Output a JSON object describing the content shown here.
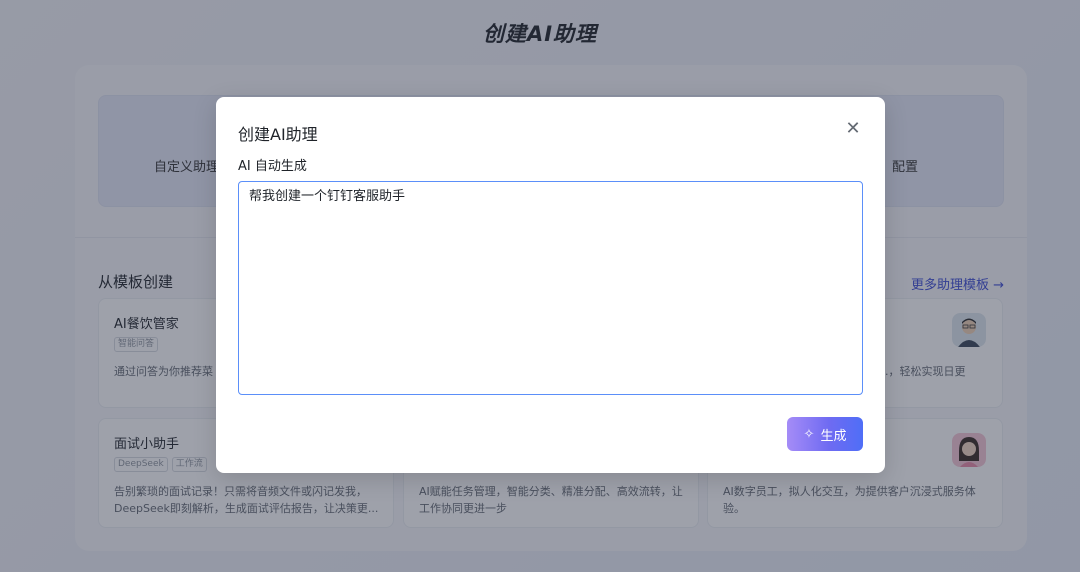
{
  "page": {
    "title": "创建AI助理"
  },
  "create_options": {
    "left_label": "自定义助理",
    "right_label": "配置"
  },
  "templates_section": {
    "title": "从模板创建",
    "more_link": "更多助理模板"
  },
  "templates": [
    {
      "name": "AI餐饮管家",
      "tags": [
        "智能问答"
      ],
      "desc": "通过问答为你推荐菜"
    },
    {
      "name": "",
      "tags": [],
      "desc": "",
      "hidden": true
    },
    {
      "name": "",
      "tags": [],
      "desc": "...，轻松实现日更",
      "avatar": "male-avatar"
    },
    {
      "name": "面试小助手",
      "tags": [
        "DeepSeek",
        "工作流"
      ],
      "desc": "告别繁琐的面试记录！只需将音频文件或闪记发我，DeepSeek即刻解析，生成面试评估报告，让决策更..."
    },
    {
      "name": "",
      "tags": [],
      "desc": "AI赋能任务管理，智能分类、精准分配、高效流转，让工作协同更进一步"
    },
    {
      "name": "",
      "tags": [],
      "desc": "AI数字员工，拟人化交互，为提供客户沉浸式服务体验。",
      "avatar": "female-avatar"
    }
  ],
  "modal": {
    "title": "创建AI助理",
    "field_label": "AI 自动生成",
    "prompt_value": "帮我创建一个钉钉客服助手",
    "generate_label": "生成",
    "close_icon": "close-icon",
    "generate_icon": "magic-wand-icon"
  },
  "colors": {
    "accent": "#4f6ef7",
    "link": "#3d4bd6",
    "input_border": "#5b8ff9"
  }
}
